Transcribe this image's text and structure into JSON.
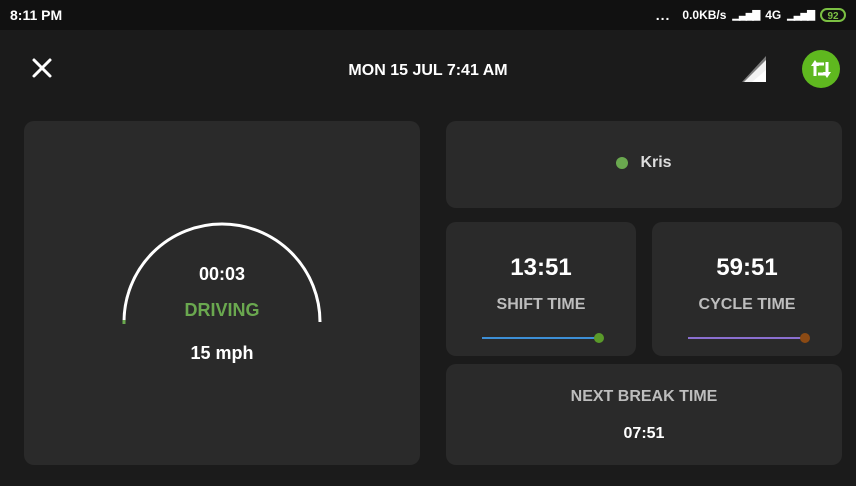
{
  "status_bar": {
    "time": "8:11 PM",
    "dots": "...",
    "network_speed": "0.0KB/s",
    "network_type": "4G",
    "battery": "92",
    "battery_color": "#7bc043"
  },
  "header": {
    "title": "MON 15 JUL 7:41 AM",
    "close_icon": "close-icon",
    "signal_icon": "signal-icon",
    "sync_icon": "sync-icon",
    "sync_color": "#5fb81f"
  },
  "gauge": {
    "elapsed": "00:03",
    "status": "DRIVING",
    "status_color": "#6aa84f",
    "speed": "15 mph"
  },
  "driver": {
    "name": "Kris",
    "status_color": "#6aa84f"
  },
  "shift": {
    "value": "13:51",
    "label": "SHIFT TIME",
    "bar_color": "#3d8fd6",
    "dot_color": "#5a9a2a"
  },
  "cycle": {
    "value": "59:51",
    "label": "CYCLE TIME",
    "bar_color": "#8a6fd0",
    "dot_color": "#8b4a14"
  },
  "next_break": {
    "label": "NEXT BREAK TIME",
    "value": "07:51"
  }
}
